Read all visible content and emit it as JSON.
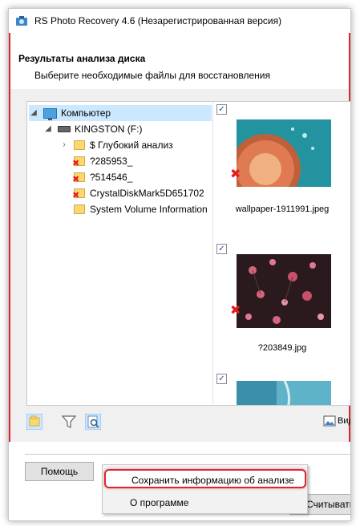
{
  "window": {
    "title": "RS Photo Recovery 4.6 (Незарегистрированная версия)"
  },
  "header": {
    "title": "Результаты анализа диска",
    "subtitle": "Выберите необходимые файлы для восстановления"
  },
  "tree": {
    "computer_label": "Компьютер",
    "drive_label": "KINGSTON (F:)",
    "items": [
      {
        "label": "$ Глубокий анализ",
        "deleted": false
      },
      {
        "label": "?285953_",
        "deleted": true
      },
      {
        "label": "?514546_",
        "deleted": true
      },
      {
        "label": "CrystalDiskMark5D651702",
        "deleted": true
      },
      {
        "label": "System Volume Information",
        "deleted": false
      }
    ]
  },
  "thumbnails": [
    {
      "filename": "wallpaper-1911991.jpeg",
      "checked": true,
      "deleted": true
    },
    {
      "filename": "?203849.jpg",
      "checked": true,
      "deleted": true
    },
    {
      "filename": "",
      "checked": true,
      "deleted": false
    }
  ],
  "toolbar": {
    "view_label": "Вид"
  },
  "buttons": {
    "help": "Помощь",
    "read": "Считывать"
  },
  "context_menu": {
    "items": [
      "Сохранить информацию об анализе",
      "О программе"
    ]
  },
  "colors": {
    "highlight_red": "#d8292f",
    "selection_blue": "#cce8ff"
  }
}
